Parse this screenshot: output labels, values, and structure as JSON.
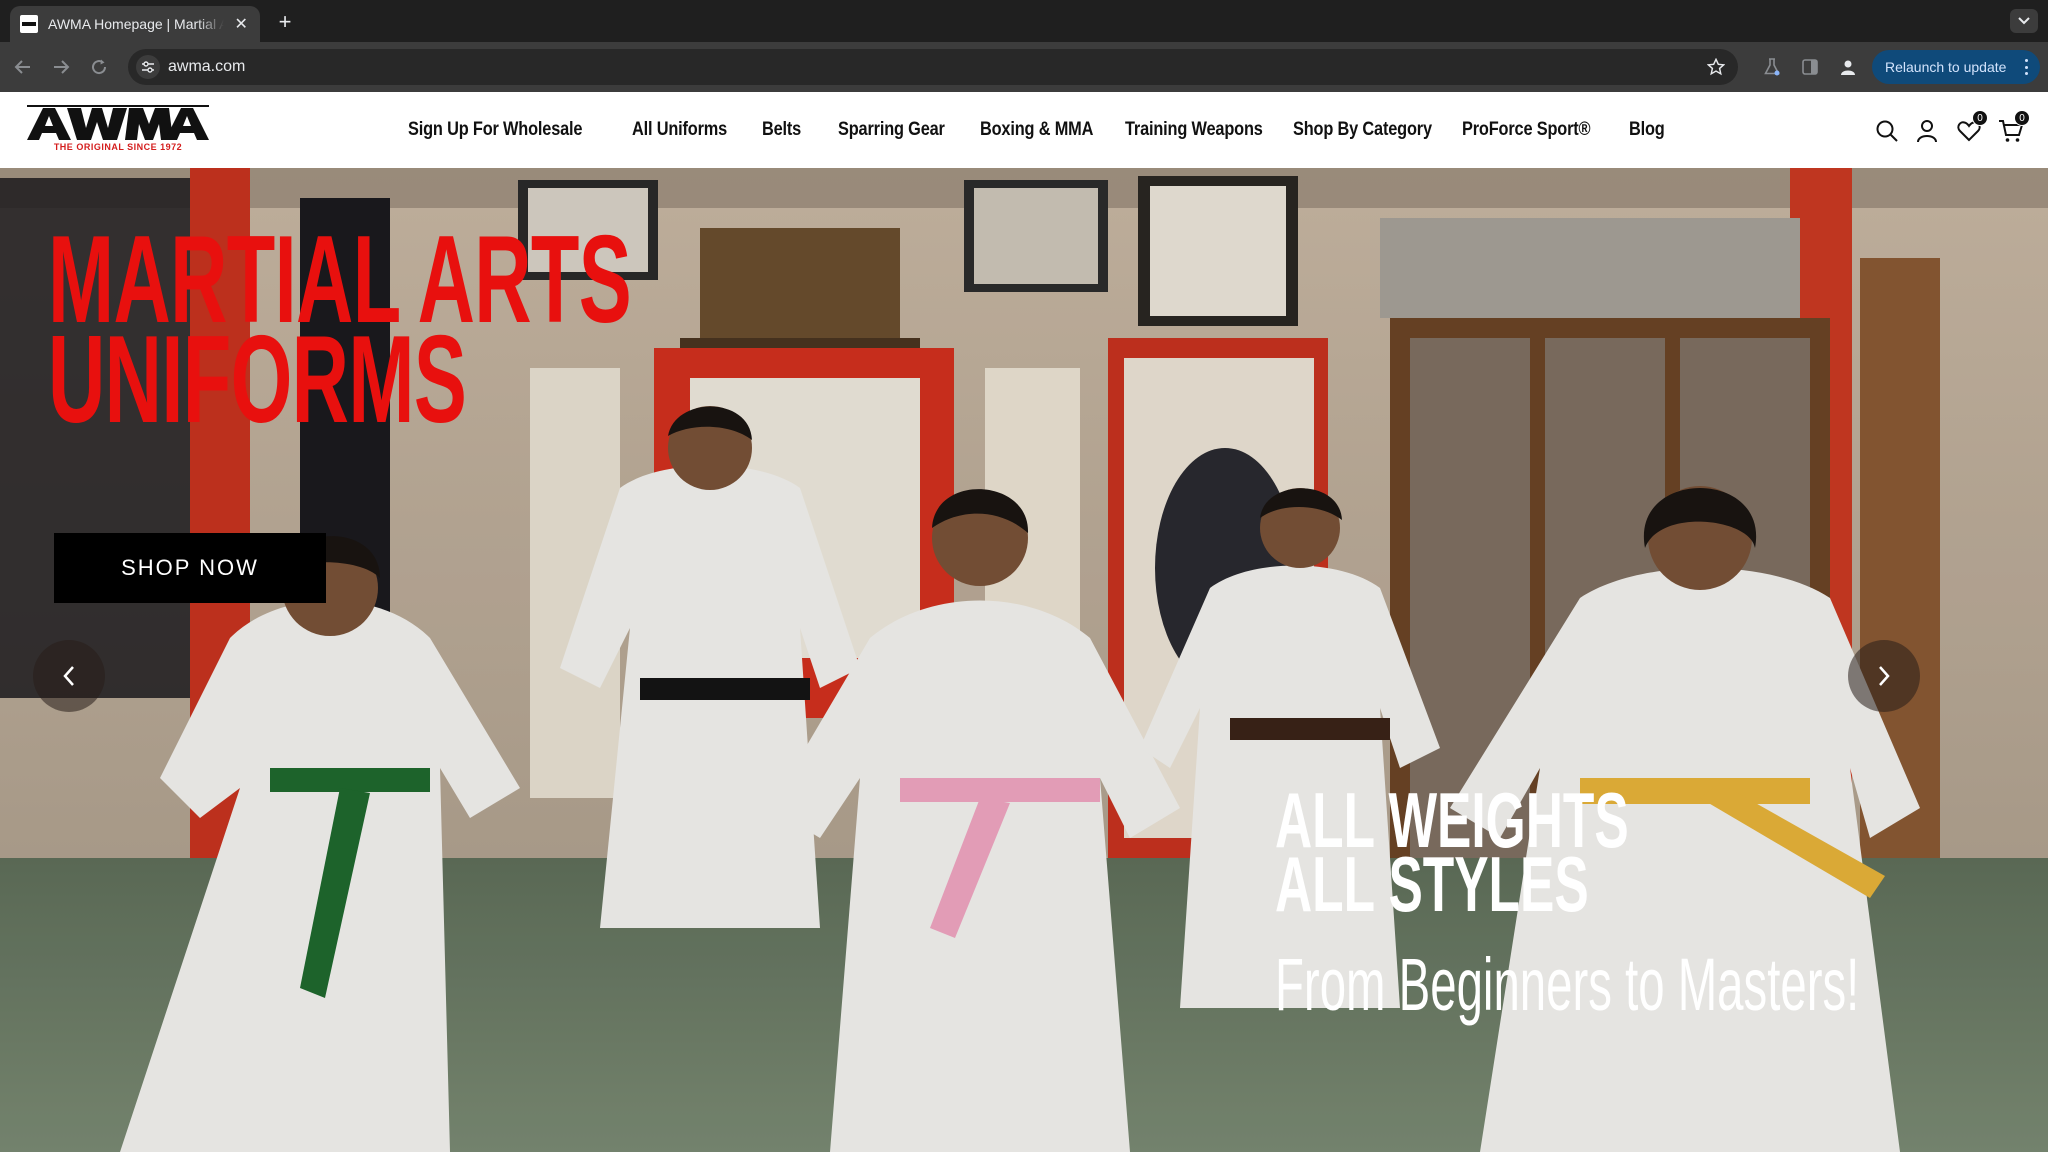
{
  "browser": {
    "tab_title": "AWMA Homepage | Martial Arts Uniforms",
    "url": "awma.com",
    "relaunch_label": "Relaunch to update"
  },
  "site": {
    "logo_text": "AWMA",
    "logo_tagline": "THE ORIGINAL SINCE 1972",
    "nav": [
      "Sign Up For Wholesale",
      "All Uniforms",
      "Belts",
      "Sparring Gear",
      "Boxing & MMA",
      "Training Weapons",
      "Shop By Category",
      "ProForce Sport®",
      "Blog"
    ],
    "wishlist_count": "0",
    "cart_count": "0"
  },
  "hero": {
    "title_line1": "MARTIAL ARTS",
    "title_line2": "UNIFORMS",
    "cta_label": "SHOP NOW",
    "subtitle_line1": "ALL WEIGHTS",
    "subtitle_line2": "ALL STYLES",
    "tagline": "From Beginners to Masters!"
  },
  "colors": {
    "brand_red": "#e8100e",
    "relaunch_bg": "#0f4a7a"
  }
}
